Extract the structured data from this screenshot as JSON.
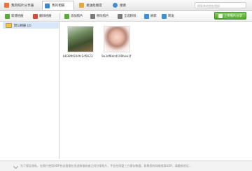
{
  "tabs": [
    {
      "label": "我的照片分享器",
      "icon": "camera-icon",
      "color": "#e8733c"
    },
    {
      "label": "我的相册",
      "icon": "album-icon",
      "color": "#3a87d6"
    },
    {
      "label": "发送给朋友",
      "icon": "send-icon",
      "color": "#e4a83a"
    },
    {
      "label": "搜索",
      "icon": "globe-icon",
      "color": "#3c8fd8"
    }
  ],
  "search": {
    "placeholder": "搜索其他朋友相册"
  },
  "toolbar": {
    "new_album": "新建相册",
    "delete_album": "删除相册",
    "add_photo": "添加照片",
    "remove_photo": "移除照片",
    "select_all": "全选移除",
    "refresh": "刷新",
    "share": "转发",
    "upload": "上传照片分享"
  },
  "sidebar": {
    "items": [
      {
        "label": "默认相册 (2)"
      }
    ]
  },
  "photos": [
    {
      "filename": "b838fb504fc2d5623"
    },
    {
      "filename": "9e3df8dcd100baa1f"
    }
  ],
  "status": {
    "text": "为了保证隐私，在照片使用UDP协议直接在发送和接收者之间分享照片，不会在网盘三方保存数据，如果您的网络禁用UDP，请重新验证..."
  },
  "colors": {
    "accent_green": "#4da22b",
    "selection": "#d8e7f9"
  }
}
